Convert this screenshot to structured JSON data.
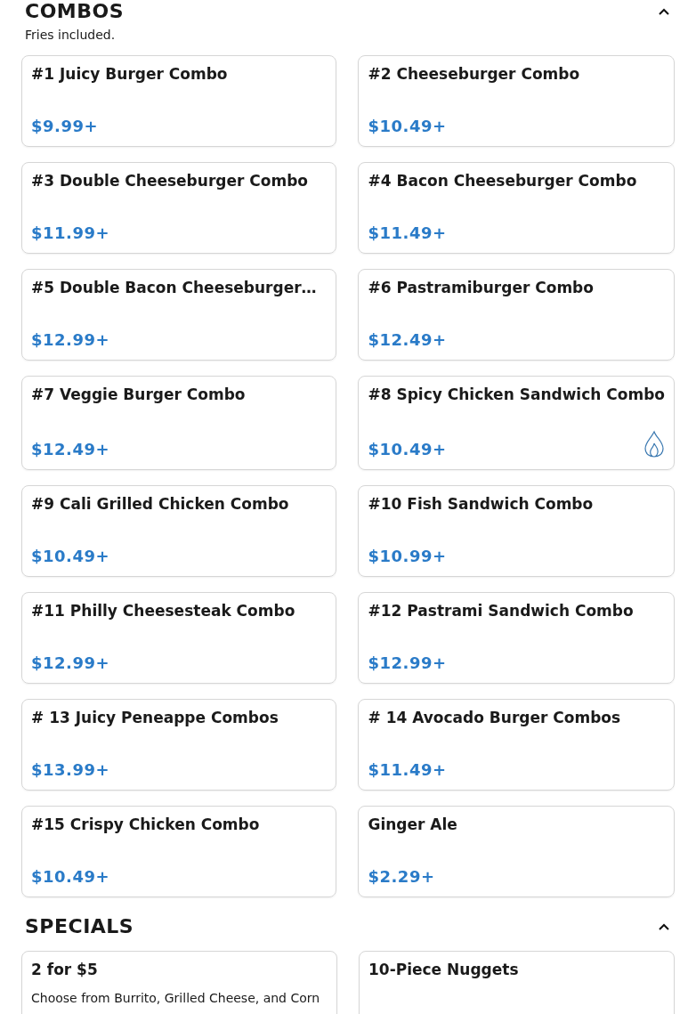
{
  "sections": [
    {
      "title": "COMBOS",
      "note": "Fries included.",
      "expanded": true,
      "items": [
        {
          "name": "#1 Juicy Burger Combo",
          "price": "$9.99+",
          "spicy": false
        },
        {
          "name": "#2 Cheeseburger Combo",
          "price": "$10.49+",
          "spicy": false
        },
        {
          "name": "#3 Double Cheeseburger Combo",
          "price": "$11.99+",
          "spicy": false
        },
        {
          "name": "#4 Bacon Cheeseburger Combo",
          "price": "$11.49+",
          "spicy": false
        },
        {
          "name": "#5 Double Bacon Cheeseburger…",
          "price": "$12.99+",
          "spicy": false
        },
        {
          "name": "#6 Pastramiburger Combo",
          "price": "$12.49+",
          "spicy": false
        },
        {
          "name": "#7 Veggie Burger Combo",
          "price": "$12.49+",
          "spicy": false
        },
        {
          "name": "#8 Spicy Chicken Sandwich Combo",
          "price": "$10.49+",
          "spicy": true
        },
        {
          "name": "#9 Cali Grilled Chicken Combo",
          "price": "$10.49+",
          "spicy": false
        },
        {
          "name": "#10 Fish Sandwich Combo",
          "price": "$10.99+",
          "spicy": false
        },
        {
          "name": "#11 Philly Cheesesteak Combo",
          "price": "$12.99+",
          "spicy": false
        },
        {
          "name": "#12 Pastrami Sandwich Combo",
          "price": "$12.99+",
          "spicy": false
        },
        {
          "name": "# 13 Juicy Peneappe Combos",
          "price": "$13.99+",
          "spicy": false
        },
        {
          "name": "# 14 Avocado Burger Combos",
          "price": "$11.49+",
          "spicy": false
        },
        {
          "name": "#15 Crispy Chicken Combo",
          "price": "$10.49+",
          "spicy": false
        },
        {
          "name": "Ginger Ale",
          "price": "$2.29+",
          "spicy": false
        }
      ]
    },
    {
      "title": "SPECIALS",
      "expanded": true,
      "items": [
        {
          "name": "2 for $5",
          "description": "Choose from Burrito, Grilled Cheese, and Corn",
          "spicy": false
        },
        {
          "name": "10-Piece Nuggets",
          "spicy": false
        }
      ]
    }
  ]
}
